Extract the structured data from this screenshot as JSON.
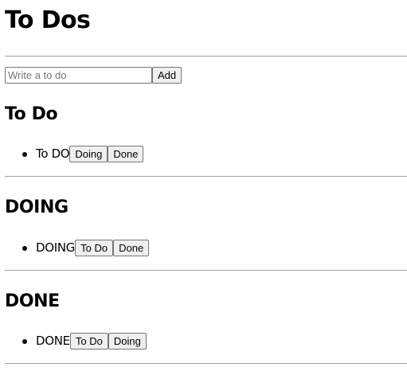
{
  "app": {
    "title": "To Dos"
  },
  "add_form": {
    "placeholder": "Write a to do",
    "value": "",
    "add_label": "Add"
  },
  "sections": {
    "todo": {
      "title": "To Do",
      "items": [
        {
          "text": "To DO",
          "actions": [
            "Doing",
            "Done"
          ]
        }
      ]
    },
    "doing": {
      "title": "DOING",
      "items": [
        {
          "text": "DOING",
          "actions": [
            "To Do",
            "Done"
          ]
        }
      ]
    },
    "done": {
      "title": "DONE",
      "items": [
        {
          "text": "DONE",
          "actions": [
            "To Do",
            "Doing"
          ]
        }
      ]
    }
  }
}
